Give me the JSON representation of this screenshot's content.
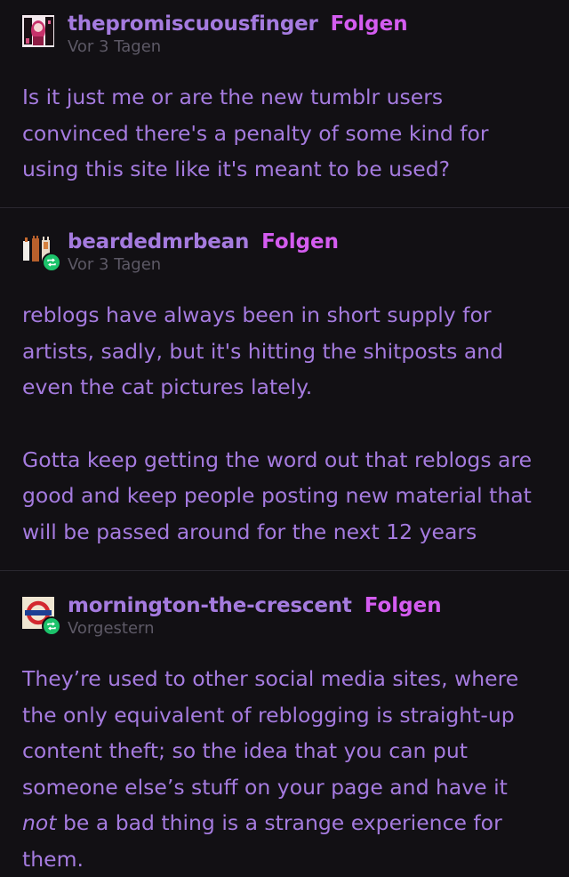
{
  "posts": [
    {
      "username": "thepromiscuousfinger",
      "follow_label": "Folgen",
      "timestamp": "Vor 3 Tagen",
      "avatar_icon": "anime-avatar-icon",
      "reblogged": false,
      "paragraphs": [
        "Is it just me or are the new tumblr users convinced there's a penalty of some kind for using this site like it's meant to be used?"
      ]
    },
    {
      "username": "beardedmrbean",
      "follow_label": "Folgen",
      "timestamp": "Vor 3 Tagen",
      "avatar_icon": "cats-avatar-icon",
      "reblogged": true,
      "paragraphs": [
        "reblogs have always been in short supply for artists, sadly, but it's hitting the shitposts and even the cat pictures lately.",
        "Gotta keep getting the word out that reblogs are good and keep people posting new material that will be passed around for the next 12 years"
      ]
    },
    {
      "username": "mornington-the-crescent",
      "follow_label": "Folgen",
      "timestamp": "Vorgestern",
      "avatar_icon": "underground-roundel-icon",
      "reblogged": true,
      "paragraphs": [
        "They’re used to other social media sites, where the only equivalent of reblogging is straight-up content theft; so the idea that you can put someone else’s stuff on your page and have it",
        "not",
        "be a bad thing is a strange experience for them."
      ]
    }
  ],
  "colors": {
    "background": "#121014",
    "text": "#a57bdf",
    "follow": "#d45cf0",
    "timestamp": "#5d5966",
    "reblog_badge": "#1cc36b"
  }
}
